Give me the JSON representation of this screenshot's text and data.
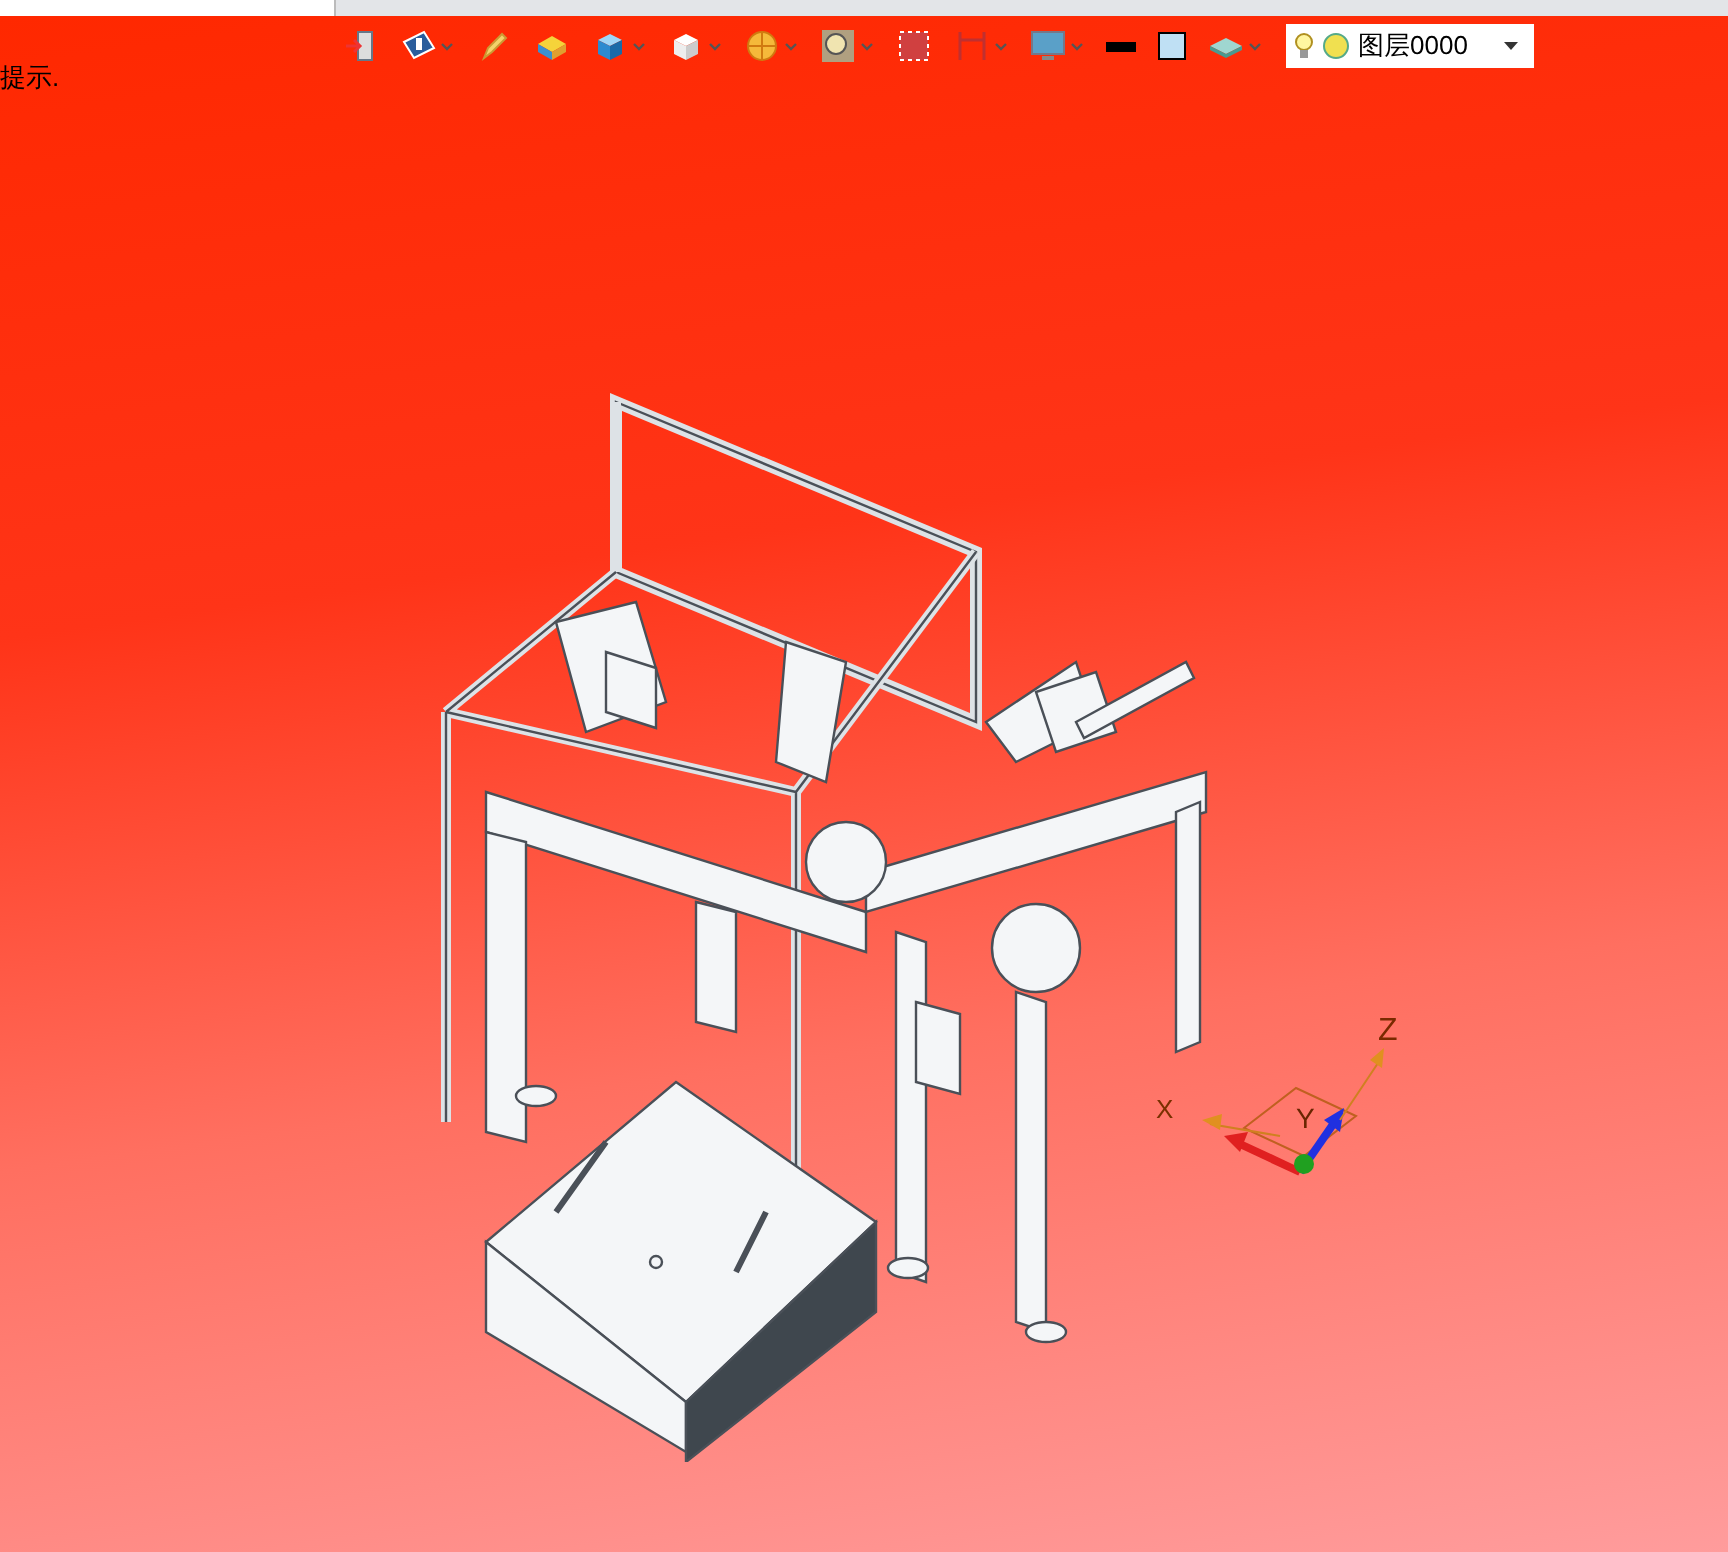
{
  "hint": "提示.",
  "toolbar": [
    {
      "kind": "exit",
      "dropdown": false
    },
    {
      "kind": "view",
      "dropdown": true
    },
    {
      "kind": "pencil",
      "dropdown": false
    },
    {
      "kind": "block",
      "dropdown": false
    },
    {
      "kind": "cube",
      "dropdown": true
    },
    {
      "kind": "whitecube",
      "dropdown": true
    },
    {
      "kind": "pie",
      "dropdown": true
    },
    {
      "kind": "zoom",
      "dropdown": true
    },
    {
      "kind": "fit",
      "dropdown": false
    },
    {
      "kind": "measure",
      "dropdown": true
    },
    {
      "kind": "monitor",
      "dropdown": true
    },
    {
      "kind": "line",
      "dropdown": false,
      "color": "#000000"
    },
    {
      "kind": "fill",
      "dropdown": false,
      "color": "#bfe0f4"
    },
    {
      "kind": "layers",
      "dropdown": true
    }
  ],
  "layer": {
    "value": "图层0000"
  },
  "axes": {
    "z": "Z",
    "y": "Y",
    "x": "X"
  }
}
